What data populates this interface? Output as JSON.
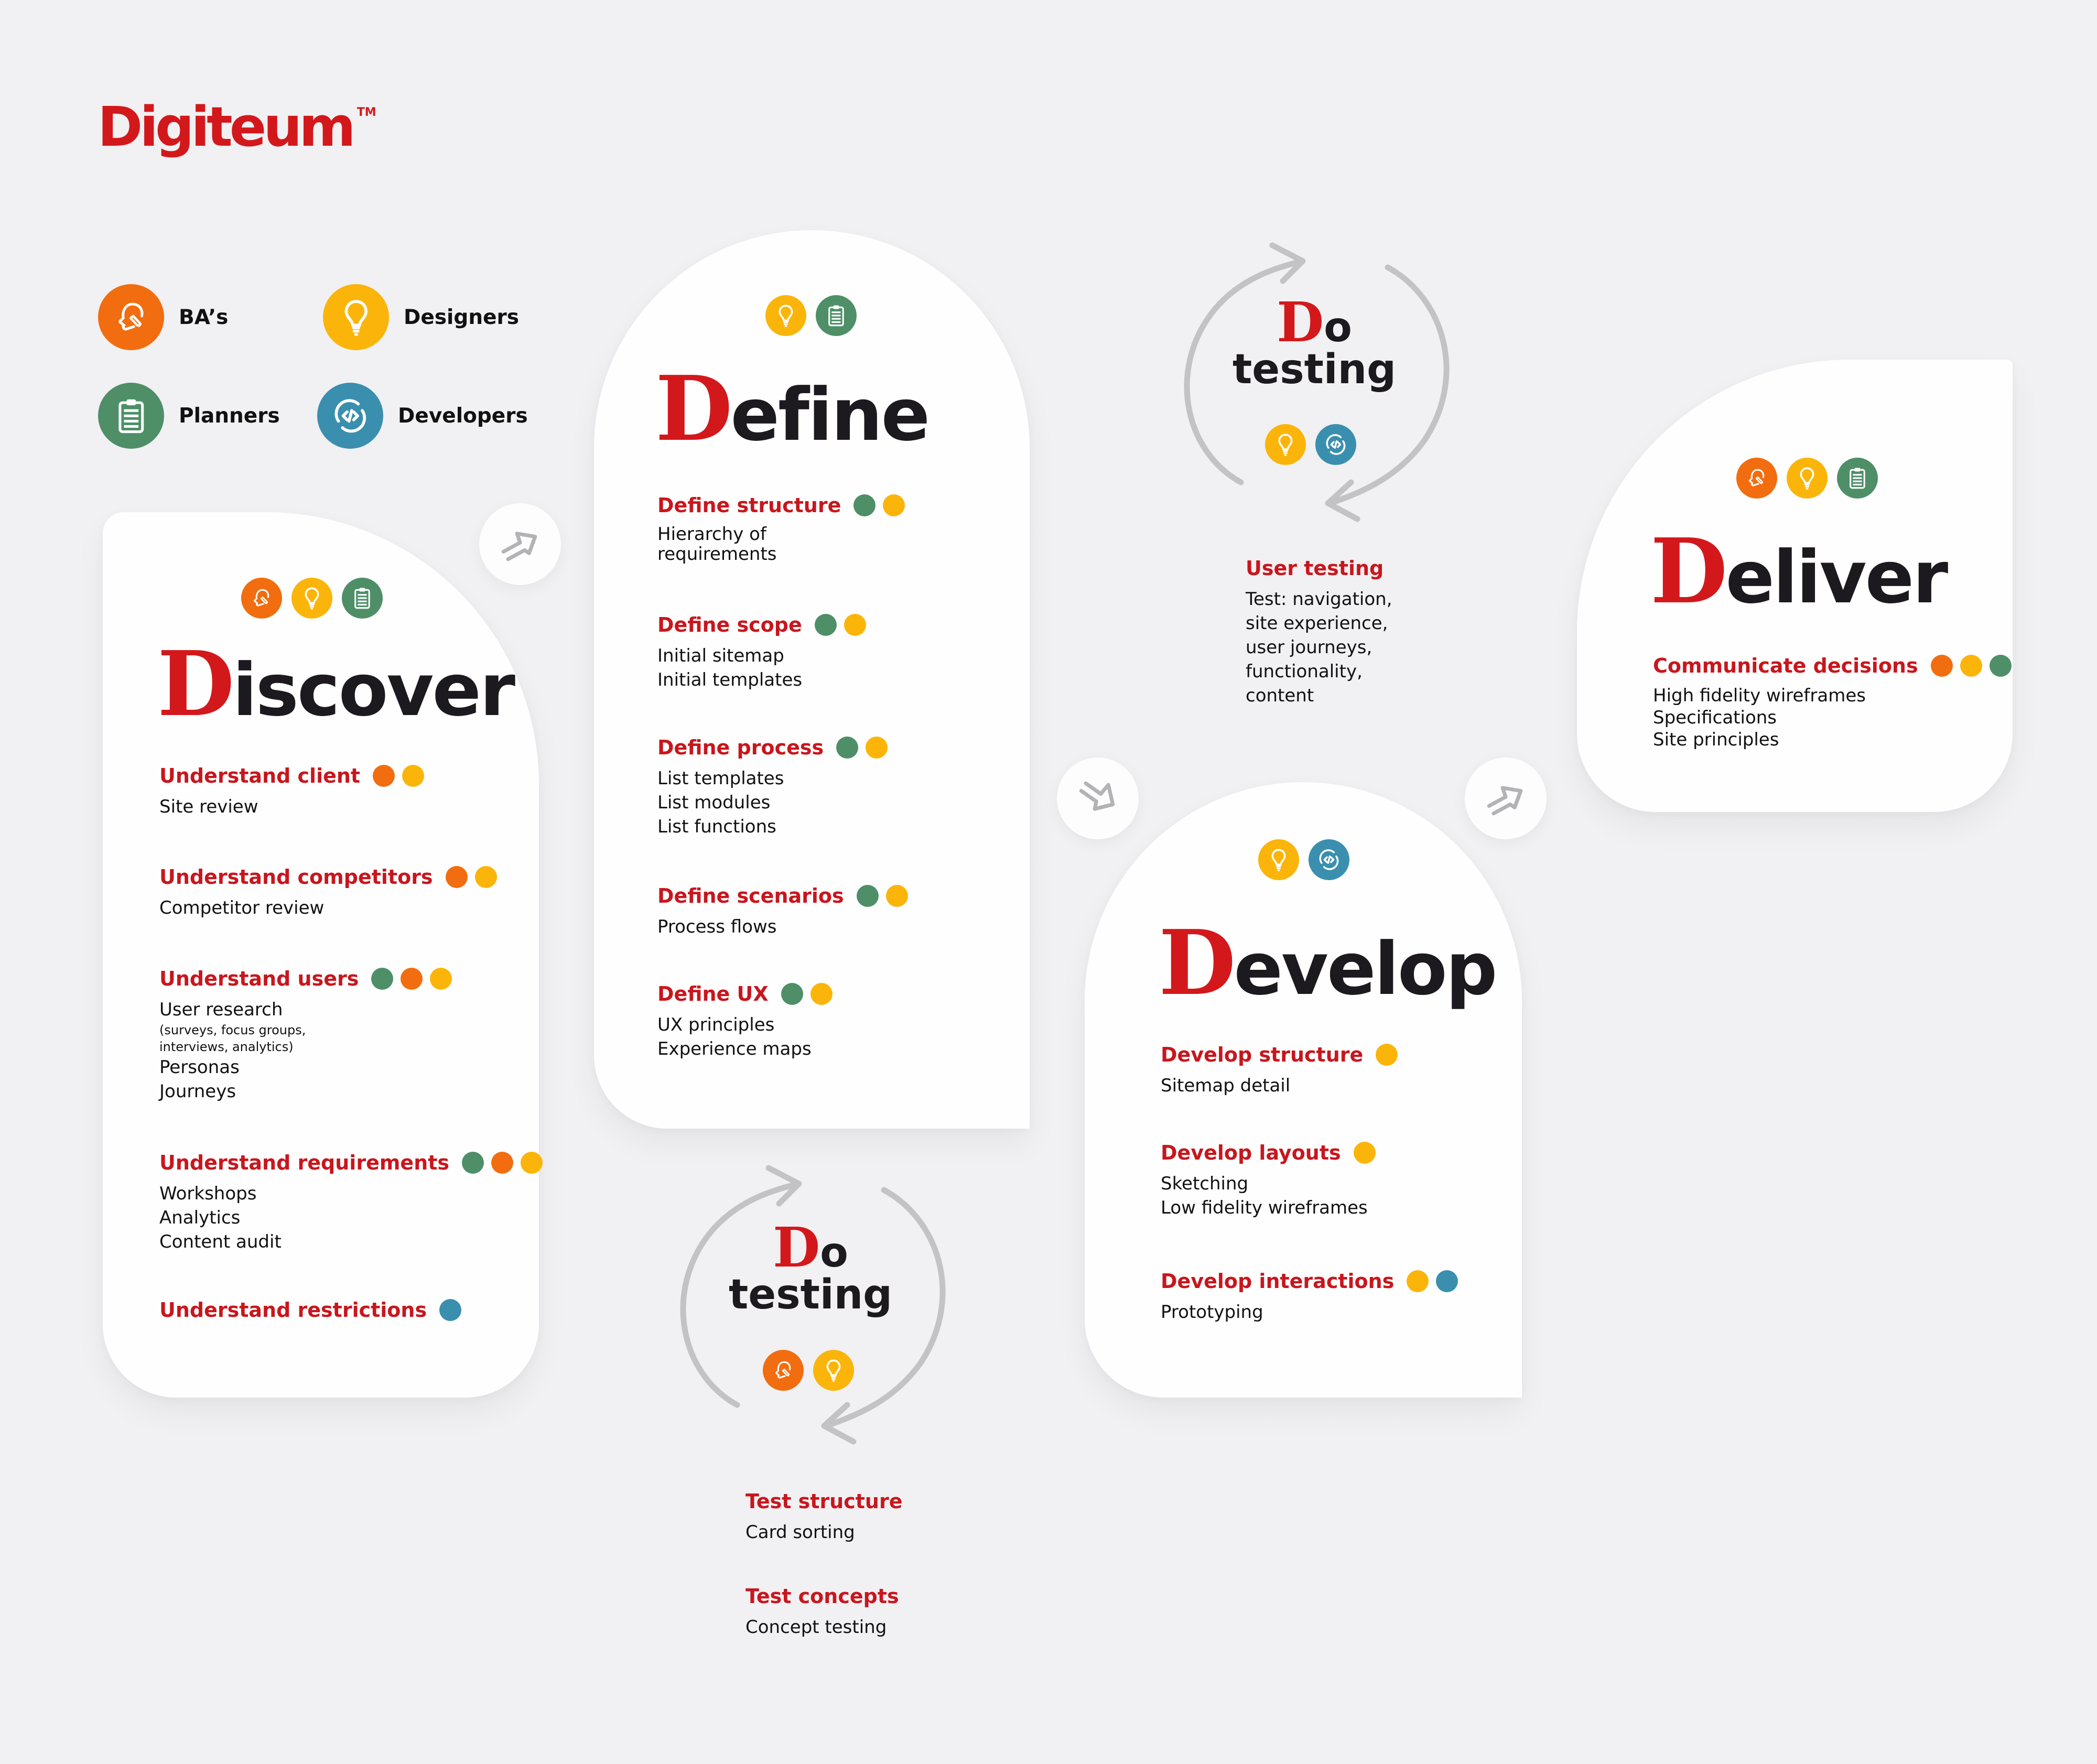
{
  "brand": {
    "name": "Digiteum",
    "trademark": "TM",
    "color": "#d3181c"
  },
  "colors": {
    "ba": "#f26d0f",
    "designer": "#fbb50a",
    "planner": "#4e8f68",
    "developer": "#3a8fae",
    "heading_red": "#c8161d",
    "background": "#f1f0f2"
  },
  "legend": [
    {
      "role": "ba",
      "label": "BA’s",
      "icon": "head-pencil-icon"
    },
    {
      "role": "designer",
      "label": "Designers",
      "icon": "lightbulb-icon"
    },
    {
      "role": "planner",
      "label": "Planners",
      "icon": "clipboard-icon"
    },
    {
      "role": "developer",
      "label": "Developers",
      "icon": "code-icon"
    }
  ],
  "phases": {
    "discover": {
      "initial": "D",
      "rest": "iscover",
      "roles": [
        "ba",
        "designer",
        "planner"
      ],
      "tasks": [
        {
          "title": "Understand client",
          "roles": [
            "ba",
            "designer"
          ],
          "items": [
            "Site review"
          ]
        },
        {
          "title": "Understand competitors",
          "roles": [
            "ba",
            "designer"
          ],
          "items": [
            "Competitor review"
          ]
        },
        {
          "title": "Understand users",
          "roles": [
            "planner",
            "ba",
            "designer"
          ],
          "items": [
            "User research"
          ],
          "note": [
            "(surveys, focus groups,",
            "interviews, analytics)"
          ],
          "items_after": [
            "Personas",
            "Journeys"
          ]
        },
        {
          "title": "Understand requirements",
          "roles": [
            "planner",
            "ba",
            "designer"
          ],
          "items": [
            "Workshops",
            "Analytics",
            "Content audit"
          ]
        },
        {
          "title": "Understand restrictions",
          "roles": [
            "developer"
          ],
          "items": []
        }
      ]
    },
    "define": {
      "initial": "D",
      "rest": "efine",
      "roles": [
        "designer",
        "planner"
      ],
      "tasks": [
        {
          "title": "Define structure",
          "roles": [
            "planner",
            "designer"
          ],
          "items": [
            "Hierarchy of",
            "requirements"
          ]
        },
        {
          "title": "Define scope",
          "roles": [
            "planner",
            "designer"
          ],
          "items": [
            "Initial sitemap",
            "Initial templates"
          ]
        },
        {
          "title": "Define process",
          "roles": [
            "planner",
            "designer"
          ],
          "items": [
            "List templates",
            "List modules",
            "List functions"
          ]
        },
        {
          "title": "Define scenarios",
          "roles": [
            "planner",
            "designer"
          ],
          "items": [
            "Process flows"
          ]
        },
        {
          "title": "Define UX",
          "roles": [
            "planner",
            "designer"
          ],
          "items": [
            "UX principles",
            "Experience maps"
          ]
        }
      ]
    },
    "testing_top": {
      "initial": "D",
      "rest": "o",
      "line2": "testing",
      "roles": [
        "designer",
        "developer"
      ],
      "tasks": [
        {
          "title": "User testing",
          "items": [
            "Test: navigation,",
            "site experience,",
            "user journeys,",
            "functionality,",
            "content"
          ]
        }
      ]
    },
    "testing_bottom": {
      "initial": "D",
      "rest": "o",
      "line2": "testing",
      "roles": [
        "ba",
        "designer"
      ],
      "tasks": [
        {
          "title": "Test structure",
          "items": [
            "Card sorting"
          ]
        },
        {
          "title": "Test concepts",
          "items": [
            "Concept testing"
          ]
        }
      ]
    },
    "develop": {
      "initial": "D",
      "rest": "evelop",
      "roles": [
        "designer",
        "developer"
      ],
      "tasks": [
        {
          "title": "Develop structure",
          "roles": [
            "designer"
          ],
          "items": [
            "Sitemap detail"
          ]
        },
        {
          "title": "Develop layouts",
          "roles": [
            "designer"
          ],
          "items": [
            "Sketching",
            "Low fidelity wireframes"
          ]
        },
        {
          "title": "Develop interactions",
          "roles": [
            "designer",
            "developer"
          ],
          "items": [
            "Prototyping"
          ]
        }
      ]
    },
    "deliver": {
      "initial": "D",
      "rest": "eliver",
      "roles": [
        "ba",
        "designer",
        "planner"
      ],
      "tasks": [
        {
          "title": "Communicate decisions",
          "roles": [
            "ba",
            "designer",
            "planner"
          ],
          "items": [
            "High fidelity wireframes",
            "Specifications",
            "Site principles"
          ]
        }
      ]
    }
  },
  "arrows": [
    {
      "name": "discover-to-define",
      "direction": "up-right"
    },
    {
      "name": "define-to-develop",
      "direction": "down-right"
    },
    {
      "name": "develop-to-deliver",
      "direction": "up-right"
    }
  ]
}
